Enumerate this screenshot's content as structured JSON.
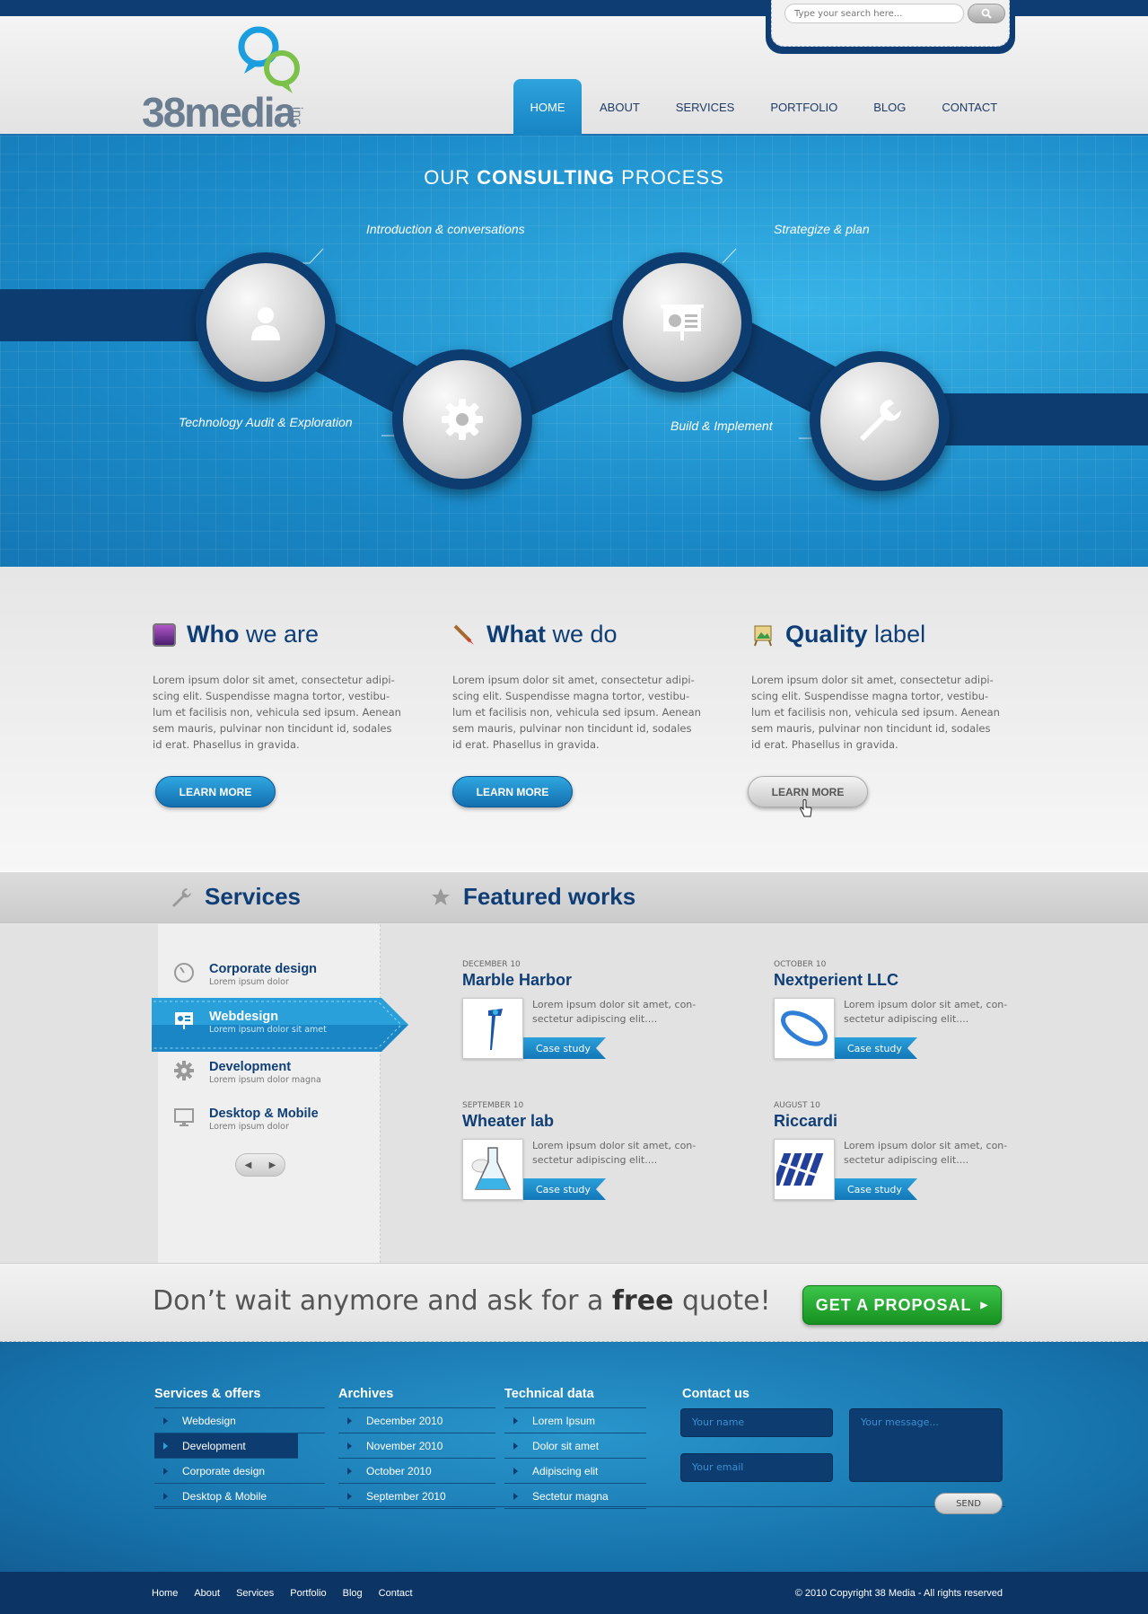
{
  "search": {
    "placeholder": "Type your search here..."
  },
  "logo": {
    "text": "38media",
    "suffix": "inc."
  },
  "nav": [
    {
      "label": "HOME",
      "active": true
    },
    {
      "label": "ABOUT"
    },
    {
      "label": "SERVICES"
    },
    {
      "label": "PORTFOLIO"
    },
    {
      "label": "BLOG"
    },
    {
      "label": "CONTACT"
    }
  ],
  "hero": {
    "title_pre": "OUR ",
    "title_bold": "CONSULTING",
    "title_post": " PROCESS",
    "steps": [
      {
        "label": "Introduction & conversations",
        "icon": "user-icon"
      },
      {
        "label": "Technology Audit & Exploration",
        "icon": "gear-icon"
      },
      {
        "label": "Strategize & plan",
        "icon": "presentation-icon"
      },
      {
        "label": "Build & Implement",
        "icon": "wrench-icon"
      }
    ]
  },
  "about": [
    {
      "title_bold": "Who",
      "title_rest": " we are",
      "icon": "monitor-icon",
      "text": "Lorem ipsum dolor sit amet, consectetur adipi-scing elit. Suspendisse magna tortor, vestibu-lum et facilisis non, vehicula sed ipsum. Aenean sem mauris, pulvinar non tincidunt id, sodales id erat. Phasellus in gravida.",
      "button": "LEARN MORE"
    },
    {
      "title_bold": "What",
      "title_rest": " we do",
      "icon": "brush-icon",
      "text": "Lorem ipsum dolor sit amet, consectetur adipi-scing elit. Suspendisse magna tortor, vestibu-lum et facilisis non, vehicula sed ipsum. Aenean sem mauris, pulvinar non tincidunt id, sodales id erat. Phasellus in gravida.",
      "button": "LEARN MORE"
    },
    {
      "title_bold": "Quality",
      "title_rest": " label",
      "icon": "picture-icon",
      "text": "Lorem ipsum dolor sit amet, consectetur adipi-scing elit. Suspendisse magna tortor, vestibu-lum et facilisis non, vehicula sed ipsum. Aenean sem mauris, pulvinar non tincidunt id, sodales id erat. Phasellus in gravida.",
      "button": "LEARN MORE"
    }
  ],
  "services": {
    "title": "Services",
    "items": [
      {
        "name": "Corporate design",
        "sub": "Lorem ipsum dolor",
        "icon": "compass-icon"
      },
      {
        "name": "Webdesign",
        "sub": "Lorem ipsum dolor sit amet",
        "icon": "presentation-icon",
        "active": true
      },
      {
        "name": "Development",
        "sub": "Lorem ipsum dolor magna",
        "icon": "gear-icon"
      },
      {
        "name": "Desktop & Mobile",
        "sub": "Lorem ipsum dolor",
        "icon": "monitor-icon"
      }
    ]
  },
  "works": {
    "title": "Featured works",
    "items": [
      {
        "date": "DECEMBER 10",
        "title": "Marble Harbor",
        "text": "Lorem ipsum dolor sit amet, con-sectetur adipiscing elit....",
        "button": "Case study"
      },
      {
        "date": "OCTOBER 10",
        "title": "Nextperient LLC",
        "text": "Lorem ipsum dolor sit amet, con-sectetur adipiscing elit....",
        "button": "Case study"
      },
      {
        "date": "SEPTEMBER 10",
        "title": "Wheater lab",
        "text": "Lorem ipsum dolor sit amet, con-sectetur adipiscing elit....",
        "button": "Case study"
      },
      {
        "date": "AUGUST 10",
        "title": "Riccardi",
        "text": "Lorem ipsum dolor sit amet, con-sectetur adipiscing elit....",
        "button": "Case study"
      }
    ]
  },
  "quote": {
    "pre": "Don’t wait anymore and ask for a ",
    "bold": "free",
    "post": " quote!",
    "button": "GET A PROPOSAL"
  },
  "footer": {
    "services": {
      "title": "Services & offers",
      "items": [
        "Webdesign",
        "Development",
        "Corporate design",
        "Desktop & Mobile"
      ]
    },
    "archives": {
      "title": "Archives",
      "items": [
        "December 2010",
        "November 2010",
        "October 2010",
        "September 2010"
      ]
    },
    "technical": {
      "title": "Technical data",
      "items": [
        "Lorem Ipsum",
        "Dolor sit amet",
        "Adipiscing elit",
        "Sectetur magna"
      ]
    },
    "contact": {
      "title": "Contact us",
      "name_placeholder": "Your name",
      "email_placeholder": "Your email",
      "message_placeholder": "Your message...",
      "send": "SEND"
    }
  },
  "bottom": {
    "links": [
      "Home",
      "About",
      "Services",
      "Portfolio",
      "Blog",
      "Contact"
    ],
    "copyright": "© 2010 Copyright 38 Media - All rights reserved"
  },
  "colors": {
    "navy": "#0f3e76",
    "blue": "#1a8ac8",
    "green": "#15911f"
  }
}
